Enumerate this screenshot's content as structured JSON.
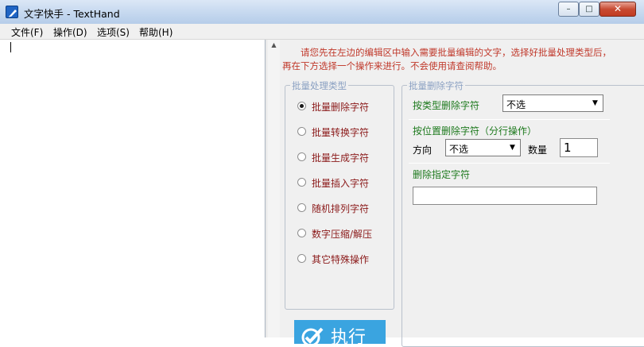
{
  "window": {
    "title": "文字快手 - TextHand",
    "icon": "pen-icon",
    "controls": {
      "minimize": "–",
      "maximize": "□",
      "close": "✕"
    }
  },
  "menu": [
    "文件(F)",
    "操作(D)",
    "选项(S)",
    "帮助(H)"
  ],
  "editor": {
    "value": ""
  },
  "instructions": "请您先在左边的编辑区中输入需要批量编辑的文字，选择好批量处理类型后，再在下方选择一个操作来进行。不会使用请查阅帮助。",
  "batch_type_group": {
    "title": "批量处理类型",
    "options": [
      "批量删除字符",
      "批量转换字符",
      "批量生成字符",
      "批量插入字符",
      "随机排列字符",
      "数字压缩/解压",
      "其它特殊操作"
    ],
    "selected_index": 0
  },
  "delete_group": {
    "title": "批量删除字符",
    "by_type_label": "按类型删除字符",
    "by_type_value": "不选",
    "by_position_label": "按位置删除字符（分行操作）",
    "direction_label": "方向",
    "direction_value": "不选",
    "count_label": "数量",
    "count_value": "1",
    "specific_label": "删除指定字符",
    "specific_value": ""
  },
  "execute_button": {
    "label": "执行",
    "icon": "check-icon"
  },
  "colors": {
    "accent": "#3aa4e0",
    "instruction_text": "#c0392b",
    "option_text": "#8b1a1a",
    "label_green": "#1e7a1e"
  }
}
